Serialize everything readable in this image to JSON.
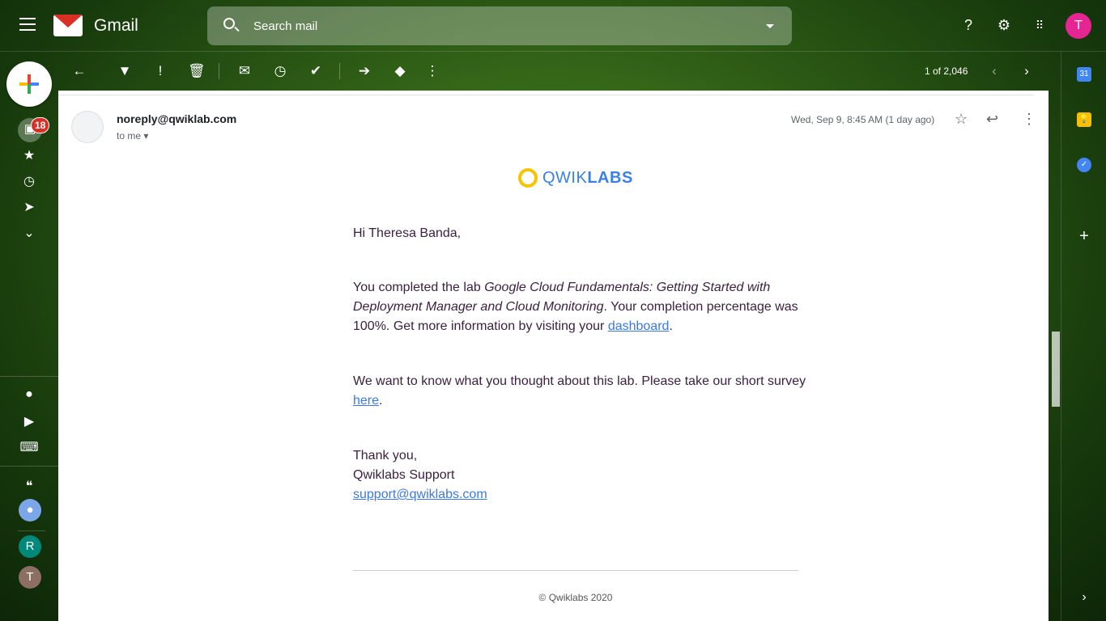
{
  "header": {
    "app_name": "Gmail",
    "search_placeholder": "Search mail",
    "avatar_letter": "T"
  },
  "sidebar": {
    "inbox_count": "18",
    "avatars": [
      "R",
      "T"
    ]
  },
  "toolbar": {
    "pagination": "1 of 2,046"
  },
  "email": {
    "sender": "noreply@qwiklab.com",
    "recipient": "to me",
    "date": "Wed, Sep 9, 8:45 AM (1 day ago)",
    "logo_a": "QWIK",
    "logo_b": "LABS",
    "greeting": "Hi Theresa Banda,",
    "p1_a": "You completed the lab ",
    "p1_lab": "Google Cloud Fundamentals: Getting Started with Deployment Manager and Cloud Monitoring",
    "p1_b": ". Your completion percentage was 100%. Get more information by visiting your ",
    "p1_link": "dashboard",
    "p1_end": ".",
    "p2_a": "We want to know what you thought about this lab. Please take our short survey ",
    "p2_link": "here",
    "p2_end": ".",
    "thanks": "Thank you,",
    "signature": "Qwiklabs Support",
    "support_email": "support@qwiklabs.com",
    "footer": "© Qwiklabs 2020"
  },
  "right_panel": {
    "calendar_day": "31"
  }
}
